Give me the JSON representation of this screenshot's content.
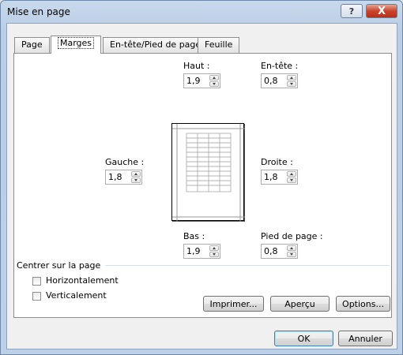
{
  "window": {
    "title": "Mise en page",
    "help_symbol": "?",
    "close_symbol": "X"
  },
  "tabs": [
    "Page",
    "Marges",
    "En-tête/Pied de page",
    "Feuille"
  ],
  "margins": {
    "haut": {
      "label": "Haut :",
      "value": "1,9"
    },
    "entete": {
      "label": "En-tête :",
      "value": "0,8"
    },
    "gauche": {
      "label": "Gauche :",
      "value": "1,8"
    },
    "droite": {
      "label": "Droite :",
      "value": "1,8"
    },
    "bas": {
      "label": "Bas :",
      "value": "1,9"
    },
    "pied": {
      "label": "Pied de page :",
      "value": "0,8"
    }
  },
  "center": {
    "title": "Centrer sur la page",
    "horizontal": {
      "label": "Horizontalement",
      "checked": false
    },
    "vertical": {
      "label": "Verticalement",
      "checked": false
    }
  },
  "buttons": {
    "print": "Imprimer...",
    "preview": "Aperçu",
    "options": "Options...",
    "ok": "OK",
    "cancel": "Annuler"
  }
}
